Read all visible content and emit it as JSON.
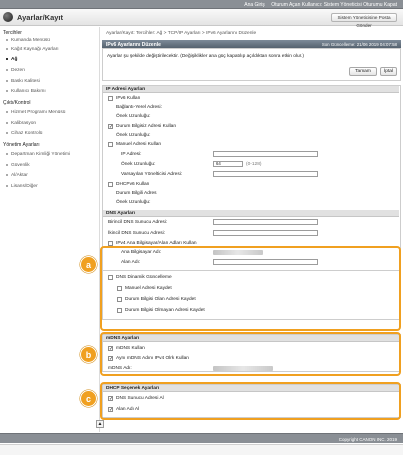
{
  "topbar": {
    "links": [
      "Ana Giriş",
      "Oturum Açan Kullanıcı: Sistem Yöneticisi Oturumu Kapat"
    ]
  },
  "header": {
    "title": "Ayarlar/Kayıt",
    "system_admin_btn": "Sistem Yöneticisine Posta Gönder"
  },
  "sidebar": {
    "sections": [
      {
        "label": "Tercihler",
        "items": [
          "Kumanda Menüsü",
          "Kağıt Kaynağı Ayarları",
          "Ağ",
          "Dezen",
          "Baskı Kalitesi",
          "Kullanıcı Bakımı"
        ]
      },
      {
        "label": "Çıktı/Kontrol",
        "items": [
          "Hizmet Programı Menüsü",
          "Kalibrasyon",
          "Cihaz Kontrolü"
        ]
      },
      {
        "label": "Yönetim Ayarları",
        "items": [
          "Departman Kimliği Yönetimi",
          "Güvenlik",
          "Al/Aktar",
          "Lisans/Diğer"
        ]
      }
    ],
    "selected": "Ağ"
  },
  "breadcrumb": "Ayarlar/Kayıt: Tercihler: Ağ > TCP/IP Ayarları > IPv6 Ayarlarını Düzenle",
  "page": {
    "title": "IPv6 Ayarlarını Düzenle",
    "last_updated": "Son Güncelleme: 21/06 2019 04:07:58",
    "info": "Ayarlar şu şekilde değiştirilecektir. (Değişiklikler ana güç kapatılıp açıldıktan sonra etkin olur.)",
    "ok_btn": "Tamam",
    "cancel_btn": "İptal"
  },
  "ip_settings": {
    "header": "IP Adresi Ayarları",
    "use_ipv6": "IPv6 Kullan",
    "link_local": "Bağlantı-Yerel Adresi:",
    "prefix_len_1": "Önek Uzunluğu:",
    "stateless": "Durum Bilgisiz Adresi Kullan",
    "prefix_len_2": "Önek Uzunluğu:",
    "manual": "Manuel Adresi Kullan",
    "ip_addr": "IP Adresi:",
    "prefix_len_3": "Önek Uzunluğu:",
    "prefix_value": "64",
    "prefix_range": "(0-128)",
    "router": "Varsayılan Yönelticisi Adresi:",
    "dhcp": "DHCPv6 Kullan",
    "stateful": "Durum Bilgili Adres",
    "prefix_len_4": "Önek Uzunluğu:"
  },
  "dns": {
    "header": "DNS Ayarları",
    "primary": "Birincil DNS Sunucu Adresi:",
    "secondary": "İkincil DNS Sunucu Adresi:",
    "same_as_ipv4": "IPv4 Ana Bilgisayar/Alan Adları Kullan",
    "host_name": "Ana Bilgisayar Adı:",
    "domain_name": "Alan Adı:",
    "dyn_update": "DNS Dinamik Güncelleme",
    "reg_manual": "Manuel Adresi Kaydet",
    "reg_stateful": "Durum Bilgisi Olan Adresi Kaydet",
    "reg_stateless": "Durum Bilgisi Olmayan Adresi Kaydet"
  },
  "mdns": {
    "header": "mDNS Ayarları",
    "use": "mDNS Kullan",
    "same_name": "Aynı mDNS Adını IPv4 Olrk Kullan",
    "name": "mDNS Adı:"
  },
  "dhcp": {
    "header": "DHCP Seçenek Ayarları",
    "dns_server": "DNS Sunucu Adresi Al",
    "domain": "Alan Adı Al"
  },
  "callouts": [
    "a",
    "b",
    "c"
  ],
  "footer": "Copyright CANON INC. 2019",
  "colors": {
    "accent": "#f0a020",
    "section_bar": "#5f6b76"
  }
}
